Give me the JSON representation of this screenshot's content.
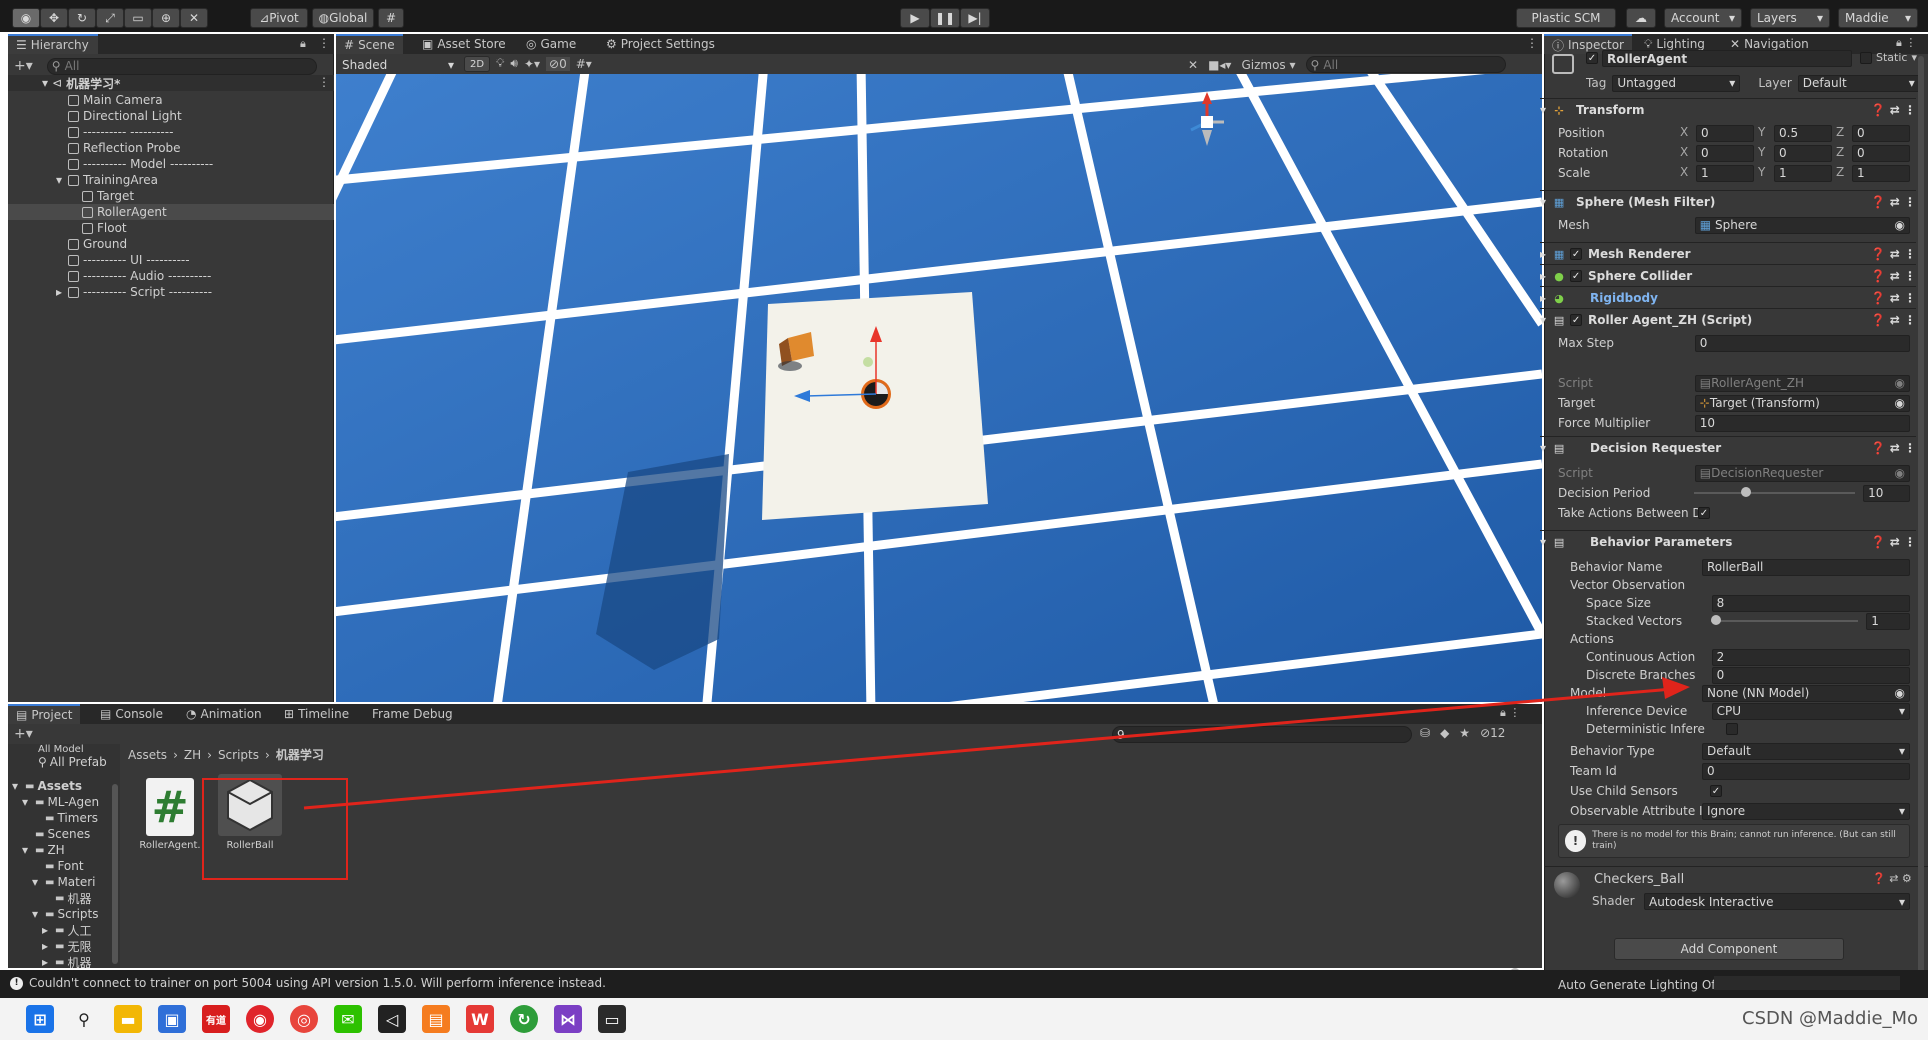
{
  "toolbar": {
    "pivot": "Pivot",
    "global": "Global",
    "plastic": "Plastic SCM",
    "account": "Account",
    "layers": "Layers",
    "user": "Maddie"
  },
  "hierarchy": {
    "tab": "Hierarchy",
    "search_placeholder": "All",
    "scene": "机器学习*",
    "items": [
      "Main Camera",
      "Directional Light",
      "---------- ----------",
      "Reflection Probe",
      "---------- Model ----------",
      "TrainingArea",
      "Target",
      "RollerAgent",
      "Floot",
      "Ground",
      "---------- UI ----------",
      "---------- Audio ----------",
      "---------- Script ----------"
    ]
  },
  "scene_tabs": {
    "scene": "Scene",
    "asset_store": "Asset Store",
    "game": "Game",
    "project_settings": "Project Settings",
    "shaded": "Shaded",
    "mode_2d": "2D",
    "hidden_count": "0",
    "gizmos": "Gizmos",
    "search_placeholder": "All"
  },
  "bottom_tabs": {
    "project": "Project",
    "console": "Console",
    "animation": "Animation",
    "timeline": "Timeline",
    "frame_debug": "Frame Debug"
  },
  "project": {
    "search_value": "9",
    "hidden_count": "12",
    "tree_top": [
      "All Model",
      "All Prefab"
    ],
    "tree": [
      "Assets",
      "ML-Agen",
      "Timers",
      "Scenes",
      "ZH",
      "Font",
      "Materi",
      "机器",
      "Scripts",
      "人工",
      "无限",
      "机器"
    ],
    "breadcrumb": [
      "Assets",
      "ZH",
      "Scripts",
      "机器学习"
    ],
    "assets": [
      {
        "name": "RollerAgent.",
        "icon": "#"
      },
      {
        "name": "RollerBall",
        "icon": "model"
      }
    ]
  },
  "inspector": {
    "tabs": [
      "Inspector",
      "Lighting",
      "Navigation"
    ],
    "object_name": "RollerAgent",
    "static": "Static",
    "tag_label": "Tag",
    "tag": "Untagged",
    "layer_label": "Layer",
    "layer": "Default",
    "transform": {
      "title": "Transform",
      "rows": [
        {
          "label": "Position",
          "x": "0",
          "y": "0.5",
          "z": "0"
        },
        {
          "label": "Rotation",
          "x": "0",
          "y": "0",
          "z": "0"
        },
        {
          "label": "Scale",
          "x": "1",
          "y": "1",
          "z": "1"
        }
      ]
    },
    "mesh_filter": {
      "title": "Sphere (Mesh Filter)",
      "mesh_label": "Mesh",
      "mesh": "Sphere"
    },
    "mesh_renderer": "Mesh Renderer",
    "sphere_collider": "Sphere Collider",
    "rigidbody": "Rigidbody",
    "roller_agent": {
      "title": "Roller Agent_ZH (Script)",
      "max_step_label": "Max Step",
      "max_step": "0",
      "script_label": "Script",
      "script": "RollerAgent_ZH",
      "target_label": "Target",
      "target": "Target (Transform)",
      "force_label": "Force Multiplier",
      "force": "10"
    },
    "decision_requester": {
      "title": "Decision Requester",
      "script_label": "Script",
      "script": "DecisionRequester",
      "period_label": "Decision Period",
      "period": "10",
      "period_fraction": 0.3,
      "take_actions_label": "Take Actions Between D"
    },
    "behavior": {
      "title": "Behavior Parameters",
      "name_label": "Behavior Name",
      "name": "RollerBall",
      "vector_obs_label": "Vector Observation",
      "space_size_label": "Space Size",
      "space_size": "8",
      "stacked_label": "Stacked Vectors",
      "stacked": "1",
      "actions_label": "Actions",
      "continuous_label": "Continuous Action",
      "continuous": "2",
      "discrete_label": "Discrete Branches",
      "discrete": "0",
      "model_label": "Model",
      "model": "None (NN Model)",
      "device_label": "Inference Device",
      "device": "CPU",
      "deterministic_label": "Deterministic Infere",
      "type_label": "Behavior Type",
      "type": "Default",
      "team_label": "Team Id",
      "team": "0",
      "child_label": "Use Child Sensors",
      "observable_label": "Observable Attribute I",
      "observable": "Ignore",
      "warning": "There is no model for this Brain; cannot run inference. (But can still train)"
    },
    "material": {
      "name": "Checkers_Ball",
      "shader_label": "Shader",
      "shader": "Autodesk Interactive"
    },
    "add_component": "Add Component"
  },
  "status": {
    "message": "Couldn't connect to trainer on port 5004 using API version 1.5.0. Will perform inference instead.",
    "lighting": "Auto Generate Lighting Off"
  },
  "watermark": "CSDN @Maddie_Mo",
  "colors": {
    "annotation_red": "#e0241b",
    "unity_dark": "#383838",
    "sky_blue": "#3a77c4"
  }
}
